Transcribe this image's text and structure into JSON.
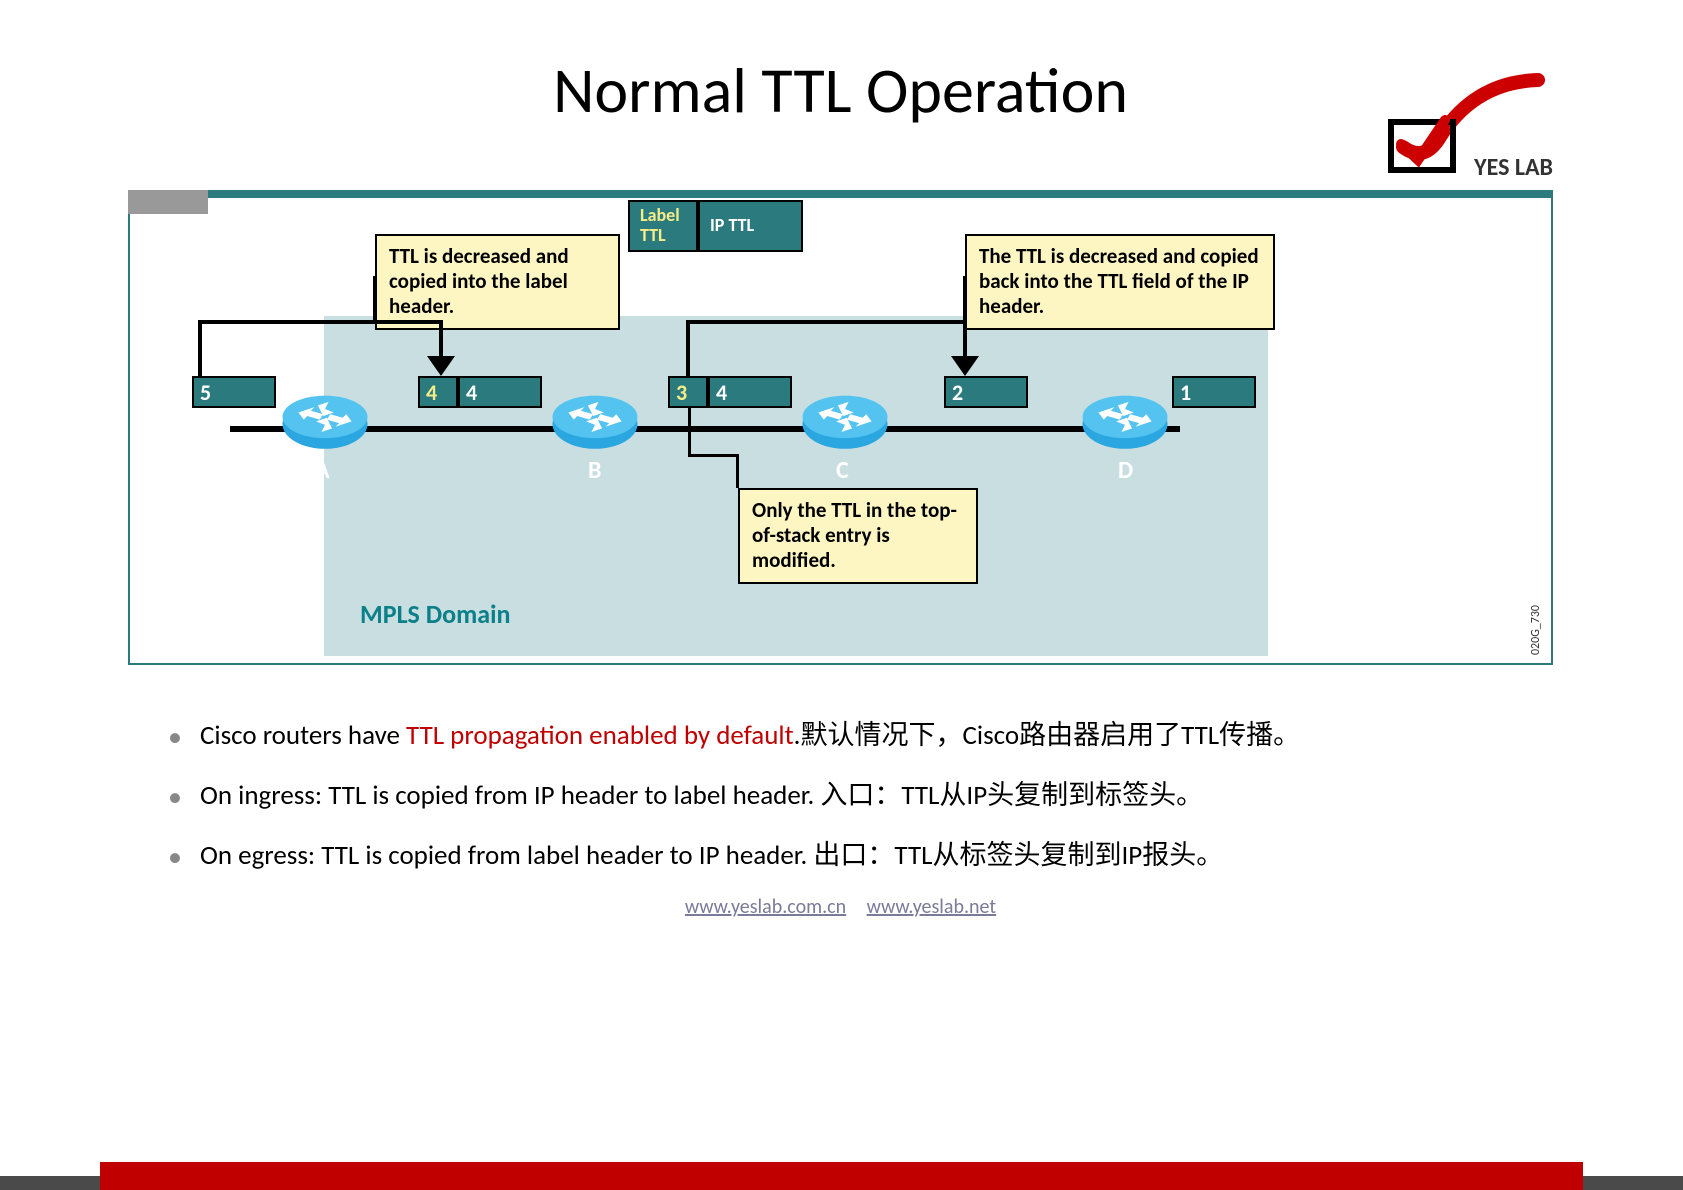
{
  "title": "Normal TTL Operation",
  "logo_text": "YES LAB",
  "legend": {
    "label_ttl": "Label TTL",
    "ip_ttl": "IP TTL"
  },
  "callouts": {
    "c1": "TTL is decreased and copied into the label header.",
    "c2": "The TTL is decreased and copied back into the TTL field of the IP header.",
    "c3": "Only the TTL in the top-of-stack entry is modified."
  },
  "packets": [
    {
      "ip": "5"
    },
    {
      "lbl": "4",
      "ip": "4"
    },
    {
      "lbl": "3",
      "ip": "4"
    },
    {
      "ip": "2"
    },
    {
      "ip": "1"
    }
  ],
  "routers": [
    "A",
    "B",
    "C",
    "D"
  ],
  "mpls_label": "MPLS Domain",
  "img_code": "020G_730",
  "bullets": [
    {
      "pre": "Cisco routers have ",
      "red": "TTL propagation enabled by default",
      "post": ".默认情况下，Cisco路由器启用了TTL传播。"
    },
    {
      "text": "On ingress: TTL is copied from IP header to label header.  入口：TTL从IP头复制到标签头。"
    },
    {
      "text": "On egress: TTL is copied from label header to IP header.   出口：TTL从标签头复制到IP报头。"
    }
  ],
  "footer": {
    "link1": "www.yeslab.com.cn",
    "link2": "www.yeslab.net"
  }
}
